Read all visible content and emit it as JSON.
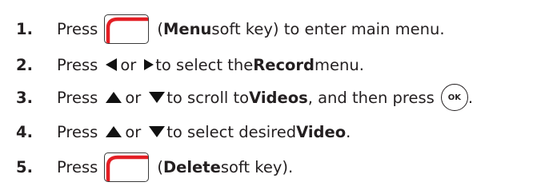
{
  "steps": [
    {
      "number": "1.",
      "press": "Press",
      "open_paren": "(",
      "bold": "Menu",
      "rest": " soft key) to enter main menu."
    },
    {
      "number": "2.",
      "press": "Press",
      "or": "or",
      "to_select": "to select the ",
      "bold": "Record",
      "rest": " menu."
    },
    {
      "number": "3.",
      "press": "Press",
      "or": "or",
      "to_scroll": "to scroll to ",
      "bold": "Videos",
      "rest": ", and then press",
      "ok_label": "OK",
      "end": "."
    },
    {
      "number": "4.",
      "press": "Press",
      "or": "or",
      "to_select": "to select desired ",
      "bold": "Video",
      "end": "."
    },
    {
      "number": "5.",
      "press": "Press",
      "open_paren": "(",
      "bold": "Delete",
      "rest": " soft key)."
    }
  ],
  "icons": {
    "soft_key": "left-soft-key-icon",
    "left": "left-arrow-icon",
    "right": "right-arrow-icon",
    "up": "up-arrow-icon",
    "down": "down-arrow-icon",
    "ok": "ok-key-icon"
  },
  "colors": {
    "soft_key_accent": "#e31e24",
    "text": "#231f20"
  }
}
